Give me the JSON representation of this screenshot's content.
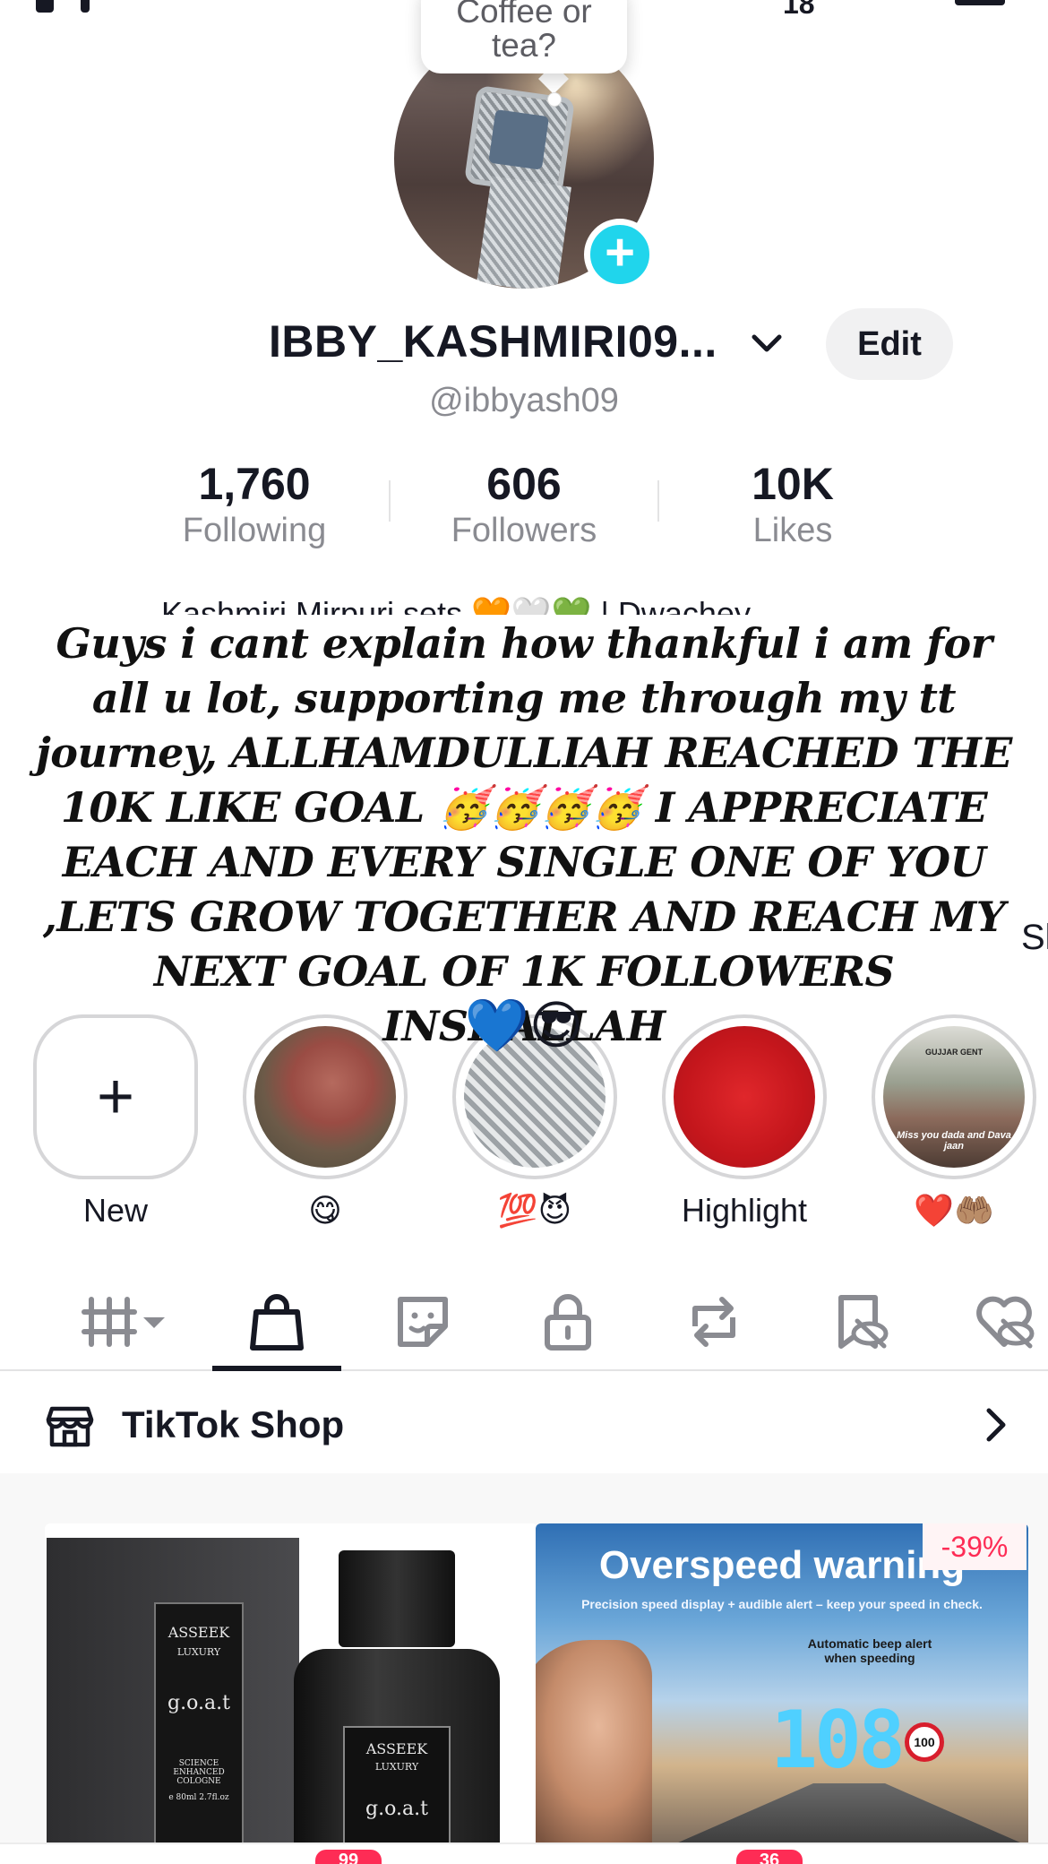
{
  "bubble": {
    "line1": "Coffee or",
    "line2": "tea?"
  },
  "profile": {
    "display_name": "IBBY_KASHMIRI09...",
    "handle": "@ibbyash09",
    "edit_label": "Edit"
  },
  "stats": {
    "following": {
      "value": "1,760",
      "label": "Following"
    },
    "followers": {
      "value": "606",
      "label": "Followers"
    },
    "likes": {
      "value": "10K",
      "label": "Likes"
    }
  },
  "bio": {
    "peek": "Kashmiri Mirpuri sets 🧡🤍💚 | Dwachey",
    "overlay_text": "Guys i cant explain how thankful i am for all u lot, supporting me through my tt journey, ALLHAMDULLIAH REACHED THE 10K LIKE GOAL 🥳🥳🥳🥳 I APPRECIATE EACH AND EVERY SINGLE ONE OF YOU ,LETS GROW TOGETHER AND REACH MY NEXT GOAL OF 1K FOLLOWERS INSHALLAH",
    "overlay_emoji": "💙😎",
    "side_fragment": "Sl"
  },
  "highlights": [
    {
      "label": "New"
    },
    {
      "label": "😋"
    },
    {
      "label": "💯😈"
    },
    {
      "label": "Highlight"
    },
    {
      "label": "❤️🤲🏽"
    }
  ],
  "highlight_captions": {
    "garden_top": "GUJJAR GENT",
    "garden_bottom": "Miss you dada and Dava jaan"
  },
  "tabs": [
    {
      "name": "videos-grid-icon"
    },
    {
      "name": "shop-bag-icon",
      "active": true
    },
    {
      "name": "sticker-icon"
    },
    {
      "name": "lock-icon"
    },
    {
      "name": "repost-icon"
    },
    {
      "name": "favorites-hidden-icon"
    },
    {
      "name": "liked-hidden-icon"
    }
  ],
  "shop": {
    "title": "TikTok Shop",
    "products": [
      {
        "brand": "ASSEEK",
        "sub": "LUXURY",
        "name": "g.o.a.t",
        "box_text": "SCIENCE ENHANCED COLOGNE",
        "size": "e 80ml  2.7fl.oz"
      },
      {
        "discount": "-39%",
        "headline": "Overspeed warning",
        "subline": "Precision speed display + audible alert – keep your speed in check.",
        "alert_note": "Automatic beep alert when speeding",
        "speed_display": "108",
        "sign": "100"
      }
    ]
  },
  "bottom_badges": [
    "99",
    "36"
  ],
  "status_bar": {
    "fragment": "18"
  },
  "colors": {
    "accent": "#20d5ec",
    "brand_red": "#fe2c55",
    "text": "#161823",
    "muted": "#8a8b91"
  }
}
